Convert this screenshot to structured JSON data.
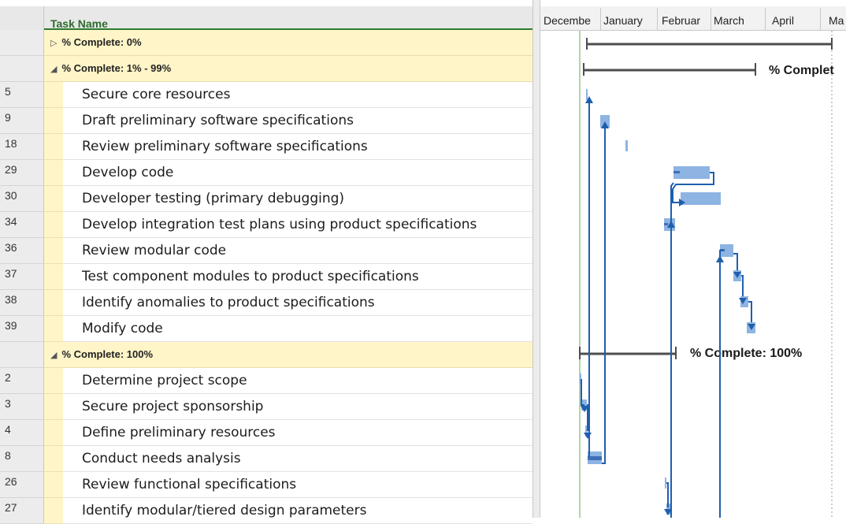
{
  "sheet": {
    "column_header": "Task Name",
    "rows": [
      {
        "kind": "group",
        "toggle": "▷",
        "label": "% Complete: 0%"
      },
      {
        "kind": "group",
        "toggle": "◢",
        "label": "% Complete: 1% - 99%"
      },
      {
        "kind": "task",
        "id": "5",
        "name": "Secure core resources"
      },
      {
        "kind": "task",
        "id": "9",
        "name": "Draft preliminary software specifications"
      },
      {
        "kind": "task",
        "id": "18",
        "name": "Review preliminary software specifications"
      },
      {
        "kind": "task",
        "id": "29",
        "name": "Develop code"
      },
      {
        "kind": "task",
        "id": "30",
        "name": "Developer testing (primary debugging)"
      },
      {
        "kind": "task",
        "id": "34",
        "name": "Develop integration test plans using product specifications"
      },
      {
        "kind": "task",
        "id": "36",
        "name": "Review modular code"
      },
      {
        "kind": "task",
        "id": "37",
        "name": "Test component modules to product specifications"
      },
      {
        "kind": "task",
        "id": "38",
        "name": "Identify anomalies to product specifications"
      },
      {
        "kind": "task",
        "id": "39",
        "name": "Modify code"
      },
      {
        "kind": "group",
        "toggle": "◢",
        "label": "% Complete: 100%"
      },
      {
        "kind": "task",
        "id": "2",
        "name": "Determine project scope"
      },
      {
        "kind": "task",
        "id": "3",
        "name": "Secure project sponsorship"
      },
      {
        "kind": "task",
        "id": "4",
        "name": "Define preliminary resources"
      },
      {
        "kind": "task",
        "id": "8",
        "name": "Conduct needs analysis"
      },
      {
        "kind": "task",
        "id": "26",
        "name": "Review functional specifications"
      },
      {
        "kind": "task",
        "id": "27",
        "name": "Identify modular/tiered design parameters"
      }
    ]
  },
  "timeline": {
    "months": [
      "Decembe",
      "January",
      "Februar",
      "March",
      "April",
      "Ma"
    ],
    "summary_labels": {
      "group_1_99": "% Complet",
      "group_100": "% Complete: 100%"
    },
    "colors": {
      "summary_bar": "#4d4d4d",
      "task_bar": "#8db4e2",
      "task_progress": "#3f6fb5",
      "link": "#1f5fae",
      "status_line": "#6aa84f",
      "group_fill": "#fff5c8"
    }
  }
}
